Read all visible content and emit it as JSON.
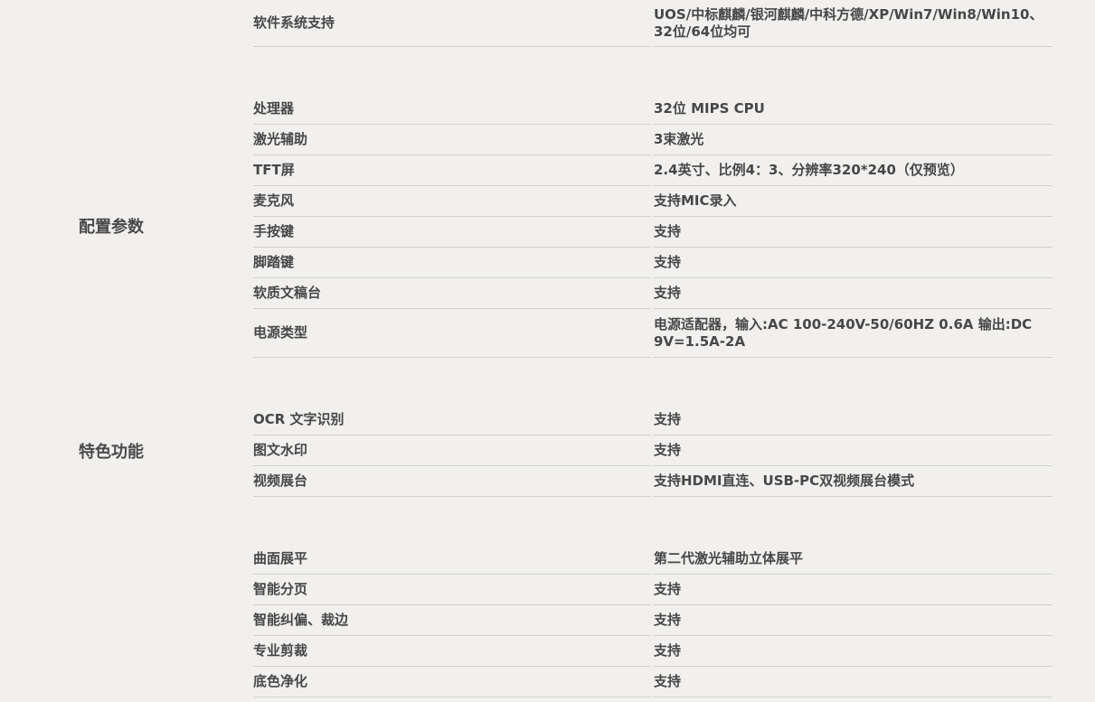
{
  "sections": [
    {
      "title": "",
      "rows": [
        {
          "label": "软件系统支持",
          "value": "UOS/中标麒麟/银河麒麟/中科方德/XP/Win7/Win8/Win10、32位/64位均可"
        }
      ]
    },
    {
      "title": "配置参数",
      "rows": [
        {
          "label": "处理器",
          "value": "32位 MIPS CPU"
        },
        {
          "label": "激光辅助",
          "value": "3束激光"
        },
        {
          "label": "TFT屏",
          "value": "2.4英寸、比例4：3、分辨率320*240（仅预览）"
        },
        {
          "label": "麦克风",
          "value": "支持MIC录入"
        },
        {
          "label": "手按键",
          "value": "支持"
        },
        {
          "label": "脚踏键",
          "value": "支持"
        },
        {
          "label": "软质文稿台",
          "value": "支持"
        },
        {
          "label": "电源类型",
          "value": "电源适配器，输入:AC 100-240V-50/60HZ 0.6A 输出:DC 9V=1.5A-2A"
        }
      ]
    },
    {
      "title": "特色功能",
      "rows": [
        {
          "label": "OCR 文字识别",
          "value": "支持"
        },
        {
          "label": "图文水印",
          "value": "支持"
        },
        {
          "label": "视频展台",
          "value": "支持HDMI直连、USB-PC双视频展台模式"
        }
      ]
    },
    {
      "title": "",
      "rows": [
        {
          "label": "曲面展平",
          "value": "第二代激光辅助立体展平"
        },
        {
          "label": "智能分页",
          "value": "支持"
        },
        {
          "label": "智能纠偏、裁边",
          "value": "支持"
        },
        {
          "label": "专业剪裁",
          "value": "支持"
        },
        {
          "label": "底色净化",
          "value": "支持"
        }
      ]
    }
  ]
}
